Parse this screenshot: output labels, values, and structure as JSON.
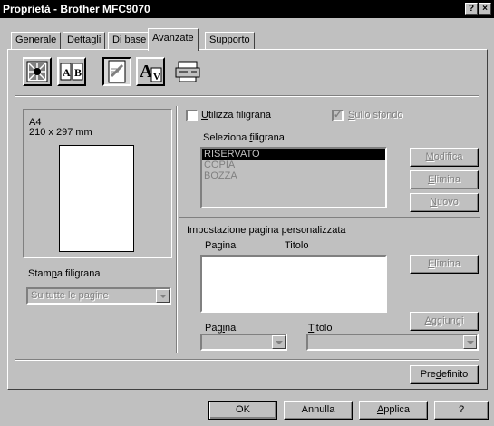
{
  "window": {
    "title": "Proprietà - Brother MFC9070",
    "help_label": "?",
    "close_label": "×"
  },
  "tabs": [
    {
      "label": "Generale"
    },
    {
      "label": "Dettagli"
    },
    {
      "label": "Di base"
    },
    {
      "label": "Avanzate"
    },
    {
      "label": "Supporto"
    }
  ],
  "active_tab": "Avanzate",
  "toolbar_icons": [
    {
      "icon": "print-quality-icon"
    },
    {
      "icon": "duplex-icon"
    },
    {
      "icon": "watermark-icon",
      "pressed": true
    },
    {
      "icon": "page-setting-icon"
    },
    {
      "icon": "device-options-icon"
    }
  ],
  "preview": {
    "paper_name": "A4",
    "paper_size": "210 x 297 mm"
  },
  "stampa": {
    "label": "Stampa filigrana",
    "value": "Su tutte le pagine"
  },
  "watermark": {
    "use_label": "Utilizza filigrana",
    "use_checked": false,
    "background_label": "Sullo sfondo",
    "background_checked": true,
    "select_label": "Seleziona filigrana",
    "items": [
      "RISERVATO",
      "COPIA",
      "BOZZA"
    ],
    "selected_index": 0,
    "modify_label": "Modifica",
    "delete_label": "Elimina",
    "new_label": "Nuovo"
  },
  "custom_page": {
    "section_label": "Impostazione pagina personalizzata",
    "col_page": "Pagina",
    "col_title": "Titolo",
    "delete_label": "Elimina",
    "add_label": "Aggiungi",
    "page_label": "Pagina",
    "title_label": "Titolo",
    "page_value": "",
    "title_value": ""
  },
  "default_button": "Predefinito",
  "footer": {
    "ok": "OK",
    "cancel": "Annulla",
    "apply": "Applica",
    "help": "?"
  }
}
